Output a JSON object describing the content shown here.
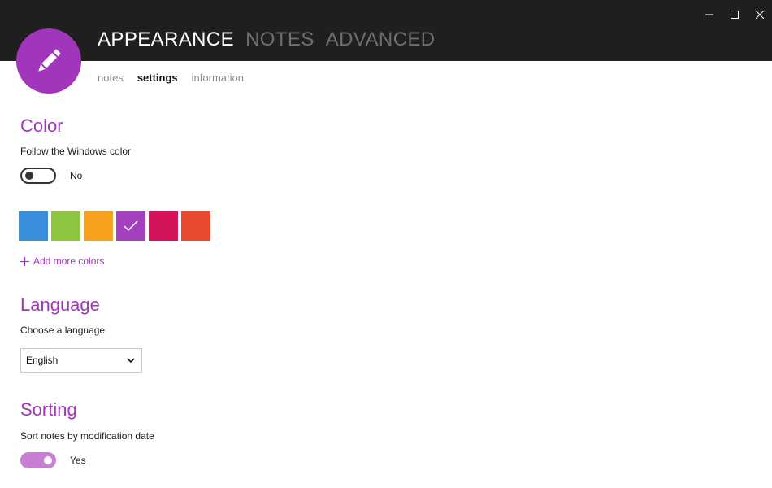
{
  "window": {
    "controls": [
      "minimize",
      "maximize",
      "close"
    ]
  },
  "main_tabs": [
    {
      "label": "APPEARANCE",
      "active": true
    },
    {
      "label": "NOTES",
      "active": false
    },
    {
      "label": "ADVANCED",
      "active": false
    }
  ],
  "sub_tabs": [
    {
      "label": "notes",
      "active": false
    },
    {
      "label": "settings",
      "active": true
    },
    {
      "label": "information",
      "active": false
    }
  ],
  "logo": {
    "icon": "pencil-icon",
    "color": "#a236bb"
  },
  "color_section": {
    "title": "Color",
    "follow_label": "Follow the Windows color",
    "toggle_value": "No",
    "toggle_on": false,
    "swatches": [
      "#3a8fdc",
      "#8cc63f",
      "#f7a01e",
      "#a43fbe",
      "#d4145a",
      "#e84a2e"
    ],
    "selected_swatch": 3,
    "add_more_label": "Add more colors"
  },
  "language_section": {
    "title": "Language",
    "choose_label": "Choose a language",
    "selected": "English"
  },
  "sorting_section": {
    "title": "Sorting",
    "sort_label": "Sort notes by modification date",
    "toggle_value": "Yes",
    "toggle_on": true
  },
  "accent_color": "#a236bb"
}
